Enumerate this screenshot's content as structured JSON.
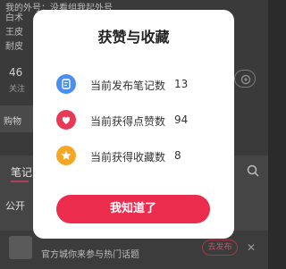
{
  "background": {
    "bio_lines": [
      "我的外号：没看组我起外号",
      "白术",
      "王皮",
      "耐皮"
    ],
    "stat_value": "46",
    "stat_label": "关注",
    "shop_label": "购物",
    "tab_label": "笔记",
    "public_label": "公开",
    "banner_text": "官方城你来参与热门话题",
    "publish_label": "去发布",
    "close_glyph": "✕"
  },
  "dialog": {
    "title": "获赞与收藏",
    "rows": [
      {
        "icon": "note-icon",
        "color": "#4a8ef0",
        "label": "当前发布笔记数",
        "value": "13"
      },
      {
        "icon": "heart-icon",
        "color": "#e83a56",
        "label": "当前获得点赞数",
        "value": "94"
      },
      {
        "icon": "star-icon",
        "color": "#f5a623",
        "label": "当前获得收藏数",
        "value": "8"
      }
    ],
    "ok_label": "我知道了",
    "accent": "#ec2c4d"
  }
}
